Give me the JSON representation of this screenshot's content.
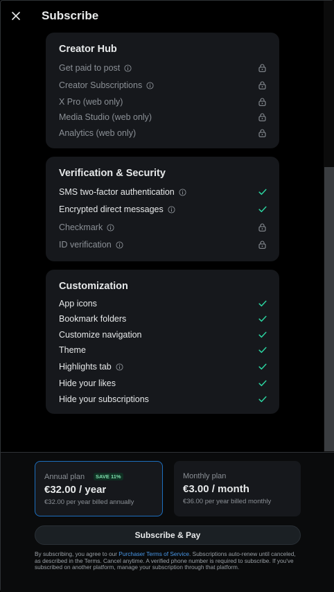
{
  "header": {
    "title": "Subscribe",
    "close_icon": "close-icon"
  },
  "sections": [
    {
      "title": "Creator Hub",
      "rows": [
        {
          "label": "Get paid to post",
          "info": true,
          "status": "locked"
        },
        {
          "label": "Creator Subscriptions",
          "info": true,
          "status": "locked"
        },
        {
          "label": "X Pro (web only)",
          "info": false,
          "status": "locked"
        },
        {
          "label": "Media Studio (web only)",
          "info": false,
          "status": "locked"
        },
        {
          "label": "Analytics (web only)",
          "info": false,
          "status": "locked"
        }
      ]
    },
    {
      "title": "Verification & Security",
      "rows": [
        {
          "label": "SMS two-factor authentication",
          "info": true,
          "status": "check"
        },
        {
          "label": "Encrypted direct messages",
          "info": true,
          "status": "check"
        },
        {
          "label": "Checkmark",
          "info": true,
          "status": "locked"
        },
        {
          "label": "ID verification",
          "info": true,
          "status": "locked"
        }
      ]
    },
    {
      "title": "Customization",
      "rows": [
        {
          "label": "App icons",
          "info": false,
          "status": "check"
        },
        {
          "label": "Bookmark folders",
          "info": false,
          "status": "check"
        },
        {
          "label": "Customize navigation",
          "info": false,
          "status": "check"
        },
        {
          "label": "Theme",
          "info": false,
          "status": "check"
        },
        {
          "label": "Highlights tab",
          "info": true,
          "status": "check"
        },
        {
          "label": "Hide your likes",
          "info": false,
          "status": "check"
        },
        {
          "label": "Hide your subscriptions",
          "info": false,
          "status": "check"
        }
      ]
    }
  ],
  "plans": {
    "annual": {
      "name": "Annual plan",
      "badge": "SAVE 11%",
      "price": "€32.00 / year",
      "note": "€32.00 per year billed annually",
      "selected": true
    },
    "monthly": {
      "name": "Monthly plan",
      "price": "€3.00 / month",
      "note": "€36.00 per year billed monthly",
      "selected": false
    }
  },
  "cta": {
    "label": "Subscribe & Pay"
  },
  "legal": {
    "before_link": "By subscribing, you agree to our ",
    "link": "Purchaser Terms of Service",
    "after_link": ". Subscriptions auto-renew until canceled, as described in the Terms. Cancel anytime. A verified phone number is required to subscribe. If you've subscribed on another platform, manage your subscription through that platform."
  },
  "colors": {
    "accent_check": "#2bd4a0",
    "link": "#4a99e9",
    "selected_border": "#1d6fbf"
  }
}
